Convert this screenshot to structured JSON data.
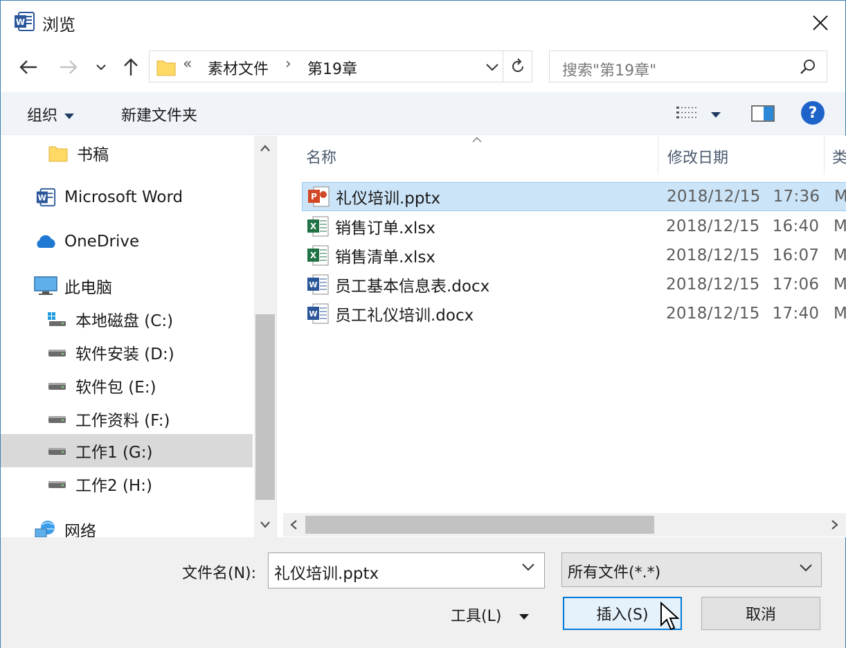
{
  "window": {
    "title": "浏览",
    "app_icon": "word-icon"
  },
  "nav": {
    "back_icon": "arrow-left-icon",
    "forward_icon": "arrow-right-icon",
    "recent_icon": "chevron-down-icon",
    "up_icon": "arrow-up-icon"
  },
  "address": {
    "overflow": "«",
    "crumbs": [
      "素材文件",
      "第19章"
    ],
    "separator": "›"
  },
  "search": {
    "placeholder": "搜索\"第19章\""
  },
  "toolbar": {
    "organize": "组织",
    "new_folder": "新建文件夹",
    "help": "?"
  },
  "sidebar": {
    "items": [
      {
        "label": "书稿",
        "icon": "folder-icon"
      },
      {
        "label": "Microsoft Word",
        "icon": "word-icon"
      },
      {
        "label": "OneDrive",
        "icon": "cloud-icon"
      },
      {
        "label": "此电脑",
        "icon": "computer-icon"
      },
      {
        "label": "本地磁盘 (C:)",
        "icon": "windows-drive-icon"
      },
      {
        "label": "软件安装 (D:)",
        "icon": "drive-icon"
      },
      {
        "label": "软件包 (E:)",
        "icon": "drive-icon"
      },
      {
        "label": "工作资料 (F:)",
        "icon": "drive-icon"
      },
      {
        "label": "工作1 (G:)",
        "icon": "drive-icon",
        "selected": true
      },
      {
        "label": "工作2 (H:)",
        "icon": "drive-icon"
      },
      {
        "label": "网络",
        "icon": "network-icon"
      }
    ]
  },
  "columns": {
    "name": "名称",
    "modified": "修改日期",
    "type": "类"
  },
  "files": [
    {
      "name": "礼仪培训.pptx",
      "date": "2018/12/15",
      "time": "17:36",
      "type": "M",
      "icon": "powerpoint-file-icon",
      "selected": true
    },
    {
      "name": "销售订单.xlsx",
      "date": "2018/12/15",
      "time": "16:40",
      "type": "M",
      "icon": "excel-file-icon"
    },
    {
      "name": "销售清单.xlsx",
      "date": "2018/12/15",
      "time": "16:07",
      "type": "M",
      "icon": "excel-file-icon"
    },
    {
      "name": "员工基本信息表.docx",
      "date": "2018/12/15",
      "time": "17:06",
      "type": "M",
      "icon": "word-file-icon"
    },
    {
      "name": "员工礼仪培训.docx",
      "date": "2018/12/15",
      "time": "17:40",
      "type": "M",
      "icon": "word-file-icon"
    }
  ],
  "footer": {
    "filename_label": "文件名(N):",
    "filename_value": "礼仪培训.pptx",
    "filetype_value": "所有文件(*.*)",
    "tools_label": "工具(L)",
    "insert_label": "插入(S)",
    "cancel_label": "取消"
  },
  "colors": {
    "accent": "#0078d7",
    "selection": "#cce4f7",
    "toolbar_bg": "#f0f4f9"
  }
}
